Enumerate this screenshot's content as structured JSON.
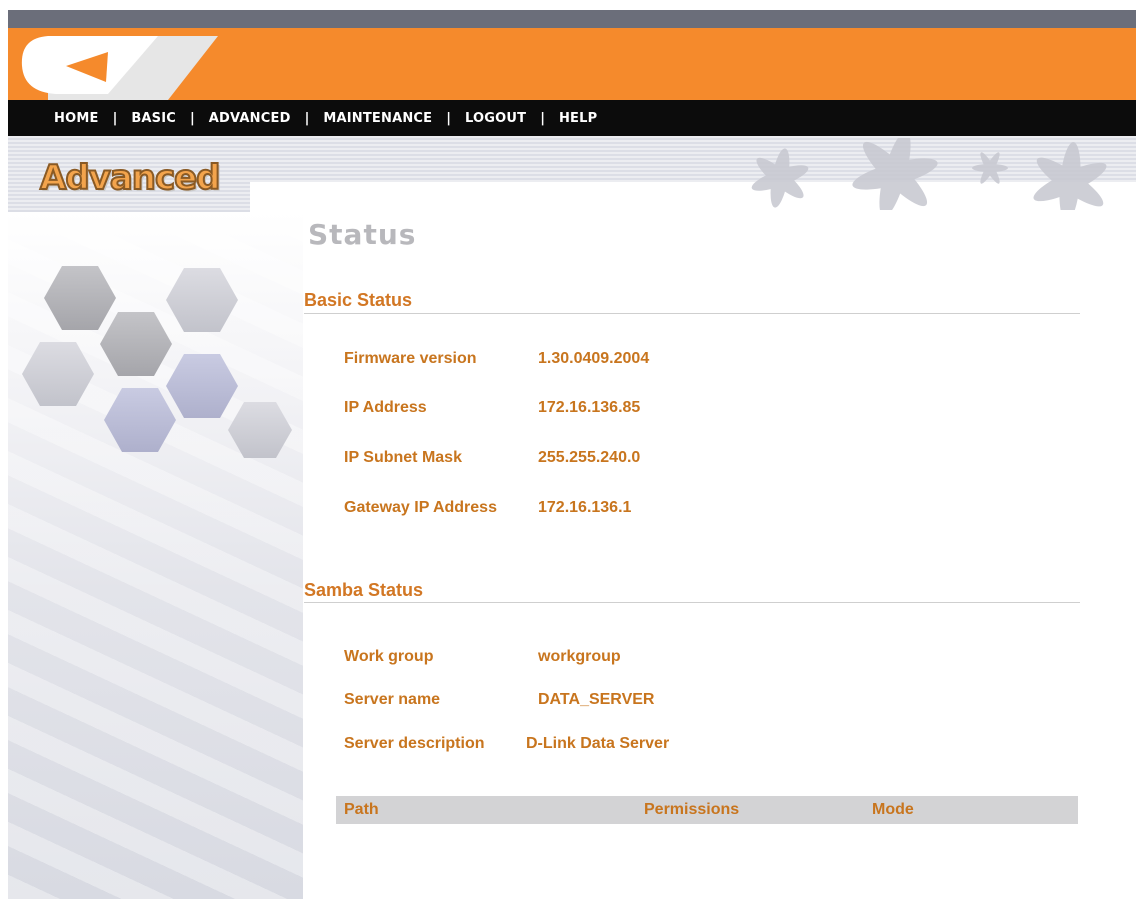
{
  "nav": {
    "items": [
      "HOME",
      "BASIC",
      "ADVANCED",
      "MAINTENANCE",
      "LOGOUT",
      "HELP"
    ],
    "separator": "|"
  },
  "banner": {
    "section_title": "Advanced"
  },
  "page": {
    "heading": "Status"
  },
  "basic_status": {
    "title": "Basic Status",
    "rows": [
      {
        "label": "Firmware version",
        "value": "1.30.0409.2004"
      },
      {
        "label": "IP Address",
        "value": "172.16.136.85"
      },
      {
        "label": "IP Subnet Mask",
        "value": "255.255.240.0"
      },
      {
        "label": "Gateway IP Address",
        "value": "172.16.136.1"
      }
    ]
  },
  "samba_status": {
    "title": "Samba Status",
    "rows": [
      {
        "label": "Work group",
        "value": "workgroup"
      },
      {
        "label": "Server name",
        "value": "DATA_SERVER"
      },
      {
        "label": "Server description",
        "value": "D-Link Data Server"
      }
    ],
    "table": {
      "columns": [
        "Path",
        "Permissions",
        "Mode"
      ]
    }
  },
  "colors": {
    "orange_banner": "#f58a2c",
    "navbar": "#0c0c0c",
    "label_text": "#c8751e",
    "heading_gray": "#b8b8bc"
  }
}
